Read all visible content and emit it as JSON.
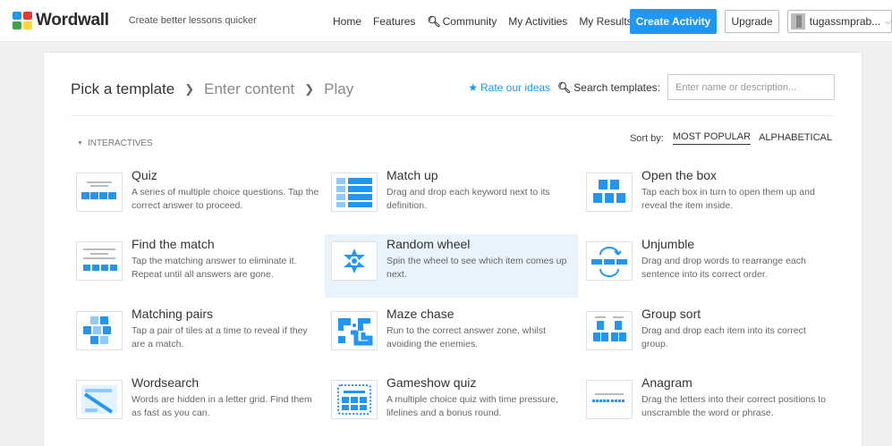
{
  "header": {
    "logo_text": "Wordwall",
    "tagline": "Create better lessons quicker",
    "nav": [
      {
        "label": "Home",
        "icon": ""
      },
      {
        "label": "Features",
        "icon": ""
      },
      {
        "label": "Community",
        "icon": "search-icon"
      },
      {
        "label": "My Activities",
        "icon": ""
      },
      {
        "label": "My Results",
        "icon": ""
      }
    ],
    "create_label": "Create Activity",
    "upgrade_label": "Upgrade",
    "username": "tugassmprab..."
  },
  "breadcrumb": {
    "step1": "Pick a template",
    "step2": "Enter content",
    "step3": "Play"
  },
  "tools": {
    "rate_label": "Rate our ideas",
    "search_label": "Search templates:",
    "search_placeholder": "Enter name or description...",
    "search_value": ""
  },
  "section": {
    "label": "INTERACTIVES"
  },
  "sort": {
    "label": "Sort by:",
    "options": [
      "MOST POPULAR",
      "ALPHABETICAL"
    ],
    "selected": "MOST POPULAR"
  },
  "templates": [
    {
      "title": "Quiz",
      "desc": "A series of multiple choice questions. Tap the correct answer to proceed.",
      "icon": "quiz-thumbnail-icon"
    },
    {
      "title": "Match up",
      "desc": "Drag and drop each keyword next to its definition.",
      "icon": "match-up-thumbnail-icon"
    },
    {
      "title": "Open the box",
      "desc": "Tap each box in turn to open them up and reveal the item inside.",
      "icon": "open-the-box-thumbnail-icon"
    },
    {
      "title": "Find the match",
      "desc": "Tap the matching answer to eliminate it. Repeat until all answers are gone.",
      "icon": "find-the-match-thumbnail-icon"
    },
    {
      "title": "Random wheel",
      "desc": "Spin the wheel to see which item comes up next.",
      "icon": "random-wheel-thumbnail-icon"
    },
    {
      "title": "Unjumble",
      "desc": "Drag and drop words to rearrange each sentence into its correct order.",
      "icon": "unjumble-thumbnail-icon"
    },
    {
      "title": "Matching pairs",
      "desc": "Tap a pair of tiles at a time to reveal if they are a match.",
      "icon": "matching-pairs-thumbnail-icon"
    },
    {
      "title": "Maze chase",
      "desc": "Run to the correct answer zone, whilst avoiding the enemies.",
      "icon": "maze-chase-thumbnail-icon"
    },
    {
      "title": "Group sort",
      "desc": "Drag and drop each item into its correct group.",
      "icon": "group-sort-thumbnail-icon"
    },
    {
      "title": "Wordsearch",
      "desc": "Words are hidden in a letter grid. Find them as fast as you can.",
      "icon": "wordsearch-thumbnail-icon"
    },
    {
      "title": "Gameshow quiz",
      "desc": "A multiple choice quiz with time pressure, lifelines and a bonus round.",
      "icon": "gameshow-quiz-thumbnail-icon"
    },
    {
      "title": "Anagram",
      "desc": "Drag the letters into their correct positions to unscramble the word or phrase.",
      "icon": "anagram-thumbnail-icon"
    }
  ],
  "colors": {
    "accent": "#2196f3",
    "logo": [
      "#2196f3",
      "#e53935",
      "#43a047",
      "#fdd835"
    ],
    "hover_tile": "#e8f3fb"
  }
}
